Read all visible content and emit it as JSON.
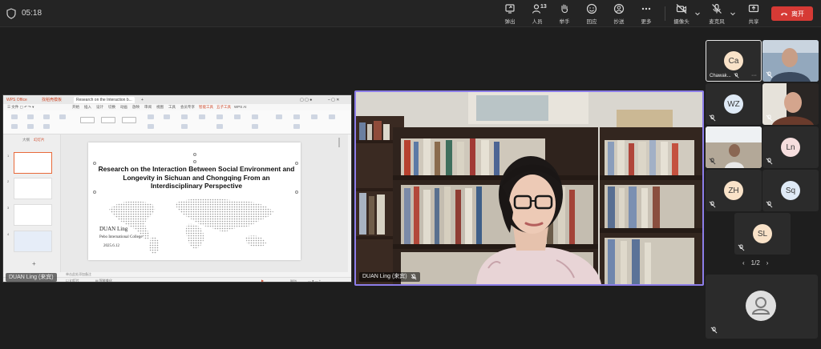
{
  "topbar": {
    "timer": "05:18",
    "tools": [
      {
        "label": "弹出",
        "icon": "popout-icon"
      },
      {
        "label": "人员",
        "icon": "people-icon",
        "count": "13"
      },
      {
        "label": "举手",
        "icon": "raise-hand-icon"
      },
      {
        "label": "回应",
        "icon": "reaction-icon"
      },
      {
        "label": "抄送",
        "icon": "user-circle-icon"
      },
      {
        "label": "更多",
        "icon": "more-icon"
      }
    ],
    "camera_label": "摄像头",
    "mic_label": "麦克风",
    "share_label": "共享",
    "leave_label": "离开"
  },
  "shared_screen": {
    "app_tabs": [
      "WPS Office",
      "找稻壳模板",
      "Research on the Interaction b..."
    ],
    "menu_items": [
      "开始",
      "插入",
      "设计",
      "切换",
      "动画",
      "放映",
      "审阅",
      "视图",
      "工具",
      "会员专享",
      "智能工具",
      "五子工具",
      "WPS AI"
    ],
    "panel_tabs": [
      "大纲",
      "幻灯片"
    ],
    "slide": {
      "title": "Research on the Interaction Between Social Environment and Longevity in Sichuan and Chongqing From an Interdisciplinary Perspective",
      "author": "DUAN Ling",
      "college": "Pebo   International College",
      "date": "2025.6.12"
    },
    "notes_placeholder": "单击此处添加备注",
    "zoom": "56%",
    "presenter_name": "DUAN Ling (来宾)"
  },
  "main_video": {
    "name": "DUAN Ling (来宾)"
  },
  "gallery": {
    "tiles": [
      {
        "initials": "Ca",
        "name": "Chawak..."
      },
      {
        "initials": "WZ"
      },
      {
        "initials": "Ln"
      },
      {
        "initials": "ZH"
      },
      {
        "initials": "Sq"
      },
      {
        "initials": "SL"
      }
    ],
    "page": "1/2"
  }
}
